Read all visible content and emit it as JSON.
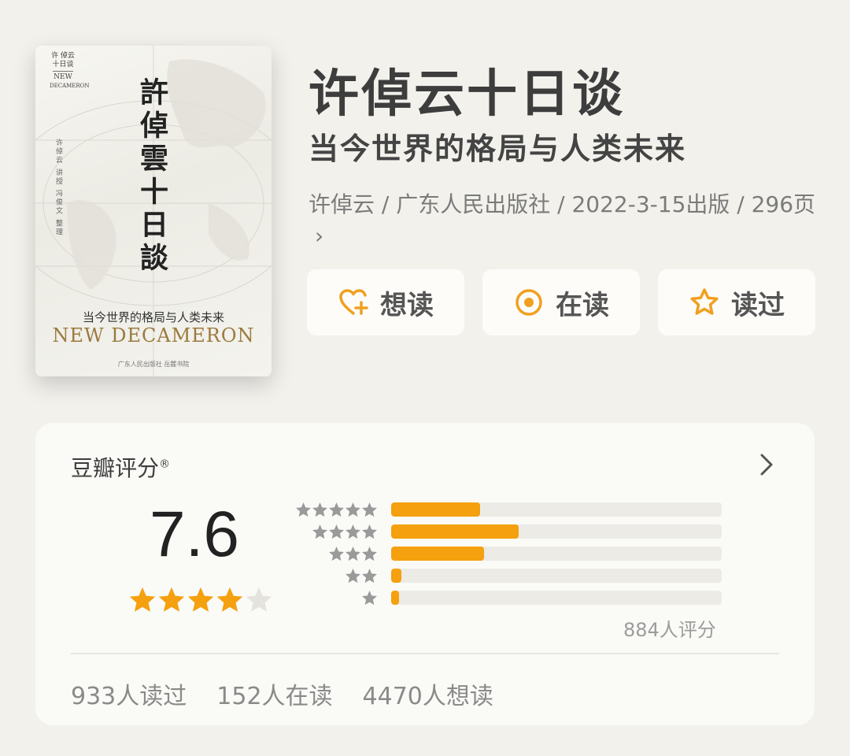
{
  "cover": {
    "spine_lines": [
      "许 倬云",
      "十日谈",
      "NEW",
      "DECAMERON"
    ],
    "spine_sub": "许倬云 讲授 冯俊文 整理",
    "title": "許倬雲十日談",
    "subtitle": "当今世界的格局与人类未来",
    "english_title": "NEW DECAMERON",
    "publishers": "广东人民出版社   岳麓书院"
  },
  "book": {
    "title": "许倬云十日谈",
    "subtitle": "当今世界的格局与人类未来",
    "meta": "许倬云 / 广东人民出版社 / 2022-3-15出版 / 296页",
    "meta_chevron": "›"
  },
  "actions": [
    {
      "label": "想读",
      "icon": "heart-plus-icon"
    },
    {
      "label": "在读",
      "icon": "target-circle-icon"
    },
    {
      "label": "读过",
      "icon": "star-outline-icon"
    }
  ],
  "rating": {
    "header": "豆瓣评分",
    "registered_mark": "®",
    "score": "7.6",
    "score_stars": 4,
    "distribution": [
      {
        "stars": 5,
        "fraction": 0.27
      },
      {
        "stars": 4,
        "fraction": 0.385
      },
      {
        "stars": 3,
        "fraction": 0.28
      },
      {
        "stars": 2,
        "fraction": 0.03
      },
      {
        "stars": 1,
        "fraction": 0.02
      }
    ],
    "count_text": "884人评分",
    "stats": [
      "933人读过",
      "152人在读",
      "4470人想读"
    ]
  },
  "colors": {
    "accent": "#f5a00e",
    "background": "#f2f1ec",
    "card": "#fafaf7"
  }
}
